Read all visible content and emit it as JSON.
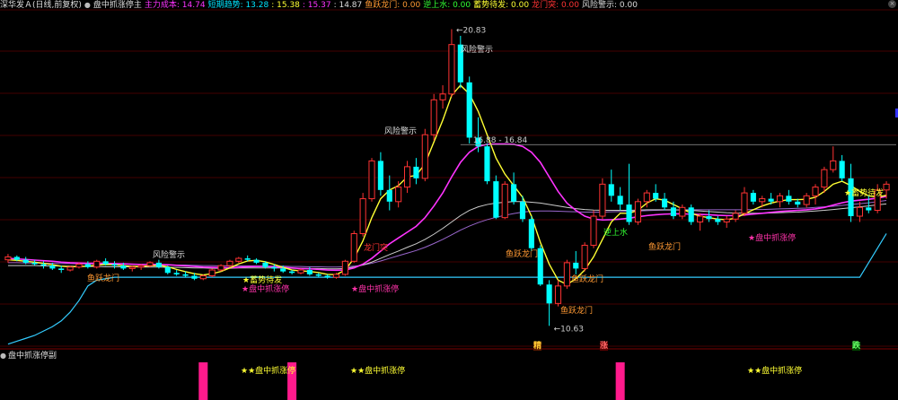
{
  "header": {
    "stock": "深华发Ａ(日线,前复权)",
    "indicator_name": "盘中抓涨停主",
    "items": [
      {
        "label": "主力成本:",
        "value": "14.74",
        "color": "#ff33ff"
      },
      {
        "label": "短期趋势:",
        "value": "13.28",
        "color": "#00e5ff"
      },
      {
        "label": ":",
        "value": "15.38",
        "color": "#ffff33"
      },
      {
        "label": ":",
        "value": "15.37",
        "color": "#ff33ff"
      },
      {
        "label": ":",
        "value": "14.87",
        "color": "#dddddd"
      },
      {
        "label": "鱼跃龙门:",
        "value": "0.00",
        "color": "#ff9933"
      },
      {
        "label": "逆上水:",
        "value": "0.00",
        "color": "#33ff33"
      },
      {
        "label": "蓄势待发:",
        "value": "0.00",
        "color": "#ffff33"
      },
      {
        "label": "龙门突:",
        "value": "0.00",
        "color": "#ff3333"
      },
      {
        "label": "风险警示:",
        "value": "0.00",
        "color": "#dddddd"
      }
    ]
  },
  "sub_panel": {
    "title": "盘中抓涨停副",
    "signal_label": "★★盘中抓涨停"
  },
  "colors": {
    "up": "#ff3333",
    "down": "#00ffff",
    "ma_yellow": "#ffff33",
    "ma_magenta": "#ff33ff",
    "ma_white": "#cccccc",
    "trend_cyan": "#33ccff",
    "signal_pink": "#ff1a8c"
  },
  "price_labels": {
    "high": "20.83",
    "low": "10.63",
    "band": "16.88 - 16.84"
  },
  "labels": {
    "risk": "风险警示",
    "yuyue": "鱼跃龙门",
    "xushi": "蓄势待发",
    "zhangting": "★盘中抓涨停",
    "xushi_star": "★蓄势待发",
    "longmen": "龙门突",
    "nishang": "逆上水"
  },
  "bottom_words": [
    "精",
    "涨",
    "跌"
  ],
  "chart_data": {
    "type": "candlestick",
    "ohlc": [
      [
        12.9,
        13.1,
        12.8,
        13.0
      ],
      [
        13.0,
        13.05,
        12.85,
        12.9
      ],
      [
        12.9,
        13.0,
        12.75,
        12.8
      ],
      [
        12.8,
        12.9,
        12.7,
        12.75
      ],
      [
        12.75,
        12.85,
        12.6,
        12.7
      ],
      [
        12.7,
        12.8,
        12.55,
        12.6
      ],
      [
        12.6,
        12.7,
        12.45,
        12.55
      ],
      [
        12.55,
        12.7,
        12.5,
        12.65
      ],
      [
        12.65,
        12.8,
        12.6,
        12.75
      ],
      [
        12.75,
        12.85,
        12.6,
        12.65
      ],
      [
        12.65,
        12.9,
        12.6,
        12.85
      ],
      [
        12.85,
        12.95,
        12.7,
        12.75
      ],
      [
        12.75,
        12.85,
        12.6,
        12.7
      ],
      [
        12.7,
        12.8,
        12.55,
        12.6
      ],
      [
        12.6,
        12.7,
        12.5,
        12.65
      ],
      [
        12.65,
        12.75,
        12.55,
        12.7
      ],
      [
        12.7,
        12.85,
        12.65,
        12.8
      ],
      [
        12.8,
        12.9,
        12.6,
        12.65
      ],
      [
        12.65,
        12.7,
        12.4,
        12.45
      ],
      [
        12.45,
        12.55,
        12.35,
        12.4
      ],
      [
        12.4,
        12.5,
        12.3,
        12.35
      ],
      [
        12.35,
        12.45,
        12.2,
        12.25
      ],
      [
        12.25,
        12.4,
        12.2,
        12.35
      ],
      [
        12.35,
        12.6,
        12.3,
        12.55
      ],
      [
        12.55,
        12.75,
        12.5,
        12.7
      ],
      [
        12.7,
        12.9,
        12.65,
        12.85
      ],
      [
        12.85,
        13.0,
        12.8,
        12.95
      ],
      [
        12.95,
        13.05,
        12.85,
        12.9
      ],
      [
        12.9,
        12.95,
        12.75,
        12.8
      ],
      [
        12.8,
        12.85,
        12.6,
        12.65
      ],
      [
        12.65,
        12.75,
        12.5,
        12.6
      ],
      [
        12.6,
        12.7,
        12.45,
        12.5
      ],
      [
        12.5,
        12.55,
        12.4,
        12.45
      ],
      [
        12.45,
        12.6,
        12.4,
        12.55
      ],
      [
        12.55,
        12.65,
        12.35,
        12.4
      ],
      [
        12.4,
        12.45,
        12.3,
        12.35
      ],
      [
        12.35,
        12.4,
        12.25,
        12.3
      ],
      [
        12.3,
        12.45,
        12.25,
        12.4
      ],
      [
        12.4,
        12.9,
        12.35,
        12.85
      ],
      [
        12.85,
        13.9,
        12.8,
        13.8
      ],
      [
        13.8,
        15.2,
        13.7,
        15.0
      ],
      [
        15.0,
        16.4,
        14.9,
        16.3
      ],
      [
        16.3,
        16.6,
        15.1,
        15.3
      ],
      [
        15.3,
        15.8,
        14.6,
        14.9
      ],
      [
        14.9,
        15.6,
        14.7,
        15.4
      ],
      [
        15.4,
        16.3,
        15.2,
        16.1
      ],
      [
        16.1,
        16.4,
        15.5,
        15.7
      ],
      [
        15.7,
        17.4,
        15.6,
        17.2
      ],
      [
        17.2,
        18.6,
        17.0,
        18.4
      ],
      [
        18.4,
        18.9,
        18.1,
        18.6
      ],
      [
        18.6,
        20.83,
        18.5,
        20.3
      ],
      [
        20.3,
        20.6,
        18.8,
        19.0
      ],
      [
        19.0,
        19.2,
        16.9,
        17.1
      ],
      [
        17.1,
        17.8,
        16.6,
        16.8
      ],
      [
        16.8,
        16.9,
        15.5,
        15.6
      ],
      [
        15.6,
        15.8,
        14.3,
        14.35
      ],
      [
        14.35,
        15.6,
        14.3,
        15.5
      ],
      [
        15.5,
        15.9,
        14.8,
        14.9
      ],
      [
        14.9,
        15.1,
        14.2,
        14.3
      ],
      [
        14.3,
        14.4,
        13.2,
        13.3
      ],
      [
        13.3,
        13.4,
        12.0,
        12.05
      ],
      [
        12.05,
        12.2,
        10.63,
        11.4
      ],
      [
        11.4,
        12.2,
        11.3,
        12.0
      ],
      [
        12.0,
        12.9,
        11.9,
        12.8
      ],
      [
        12.8,
        13.2,
        12.4,
        12.6
      ],
      [
        12.6,
        13.5,
        12.5,
        13.4
      ],
      [
        13.4,
        14.6,
        13.3,
        14.4
      ],
      [
        14.4,
        15.7,
        14.3,
        15.5
      ],
      [
        15.5,
        16.0,
        14.9,
        15.1
      ],
      [
        15.1,
        15.4,
        14.6,
        14.8
      ],
      [
        14.8,
        16.2,
        14.1,
        14.2
      ],
      [
        14.2,
        15.0,
        14.1,
        14.9
      ],
      [
        14.9,
        15.3,
        14.7,
        15.2
      ],
      [
        15.2,
        15.5,
        14.9,
        15.0
      ],
      [
        15.0,
        15.2,
        14.6,
        14.7
      ],
      [
        14.7,
        14.9,
        14.3,
        14.4
      ],
      [
        14.4,
        14.8,
        14.3,
        14.7
      ],
      [
        14.7,
        14.8,
        14.1,
        14.2
      ],
      [
        14.2,
        14.5,
        13.9,
        14.4
      ],
      [
        14.4,
        14.6,
        14.2,
        14.3
      ],
      [
        14.3,
        14.4,
        14.1,
        14.2
      ],
      [
        14.2,
        14.4,
        14.0,
        14.3
      ],
      [
        14.3,
        14.6,
        14.2,
        14.5
      ],
      [
        14.5,
        15.4,
        14.4,
        15.2
      ],
      [
        15.2,
        15.3,
        14.8,
        14.9
      ],
      [
        14.9,
        15.1,
        14.7,
        15.0
      ],
      [
        15.0,
        15.2,
        14.8,
        14.9
      ],
      [
        14.9,
        15.2,
        14.7,
        15.1
      ],
      [
        15.1,
        15.3,
        14.8,
        14.9
      ],
      [
        14.9,
        15.0,
        14.7,
        14.8
      ],
      [
        14.8,
        15.2,
        14.7,
        15.1
      ],
      [
        15.1,
        15.5,
        14.8,
        15.4
      ],
      [
        15.4,
        16.1,
        15.2,
        16.0
      ],
      [
        16.0,
        16.8,
        15.9,
        16.3
      ],
      [
        16.3,
        16.5,
        15.6,
        15.7
      ],
      [
        15.7,
        16.2,
        14.2,
        14.4
      ],
      [
        14.4,
        14.9,
        14.2,
        14.7
      ],
      [
        14.7,
        15.1,
        14.5,
        14.6
      ],
      [
        14.6,
        15.5,
        14.5,
        15.3
      ],
      [
        15.3,
        15.6,
        15.0,
        15.5
      ]
    ],
    "yellow_ma": [
      12.9,
      12.88,
      12.85,
      12.82,
      12.78,
      12.73,
      12.68,
      12.66,
      12.67,
      12.68,
      12.72,
      12.74,
      12.73,
      12.7,
      12.67,
      12.67,
      12.69,
      12.71,
      12.66,
      12.57,
      12.49,
      12.42,
      12.38,
      12.42,
      12.5,
      12.62,
      12.76,
      12.86,
      12.88,
      12.83,
      12.74,
      12.64,
      12.55,
      12.52,
      12.5,
      12.46,
      12.4,
      12.39,
      12.55,
      12.95,
      13.55,
      14.35,
      15.0,
      15.3,
      15.45,
      15.75,
      15.8,
      16.2,
      16.95,
      17.7,
      18.55,
      18.9,
      18.6,
      18.0,
      17.2,
      16.4,
      15.85,
      15.45,
      15.05,
      14.4,
      13.5,
      12.75,
      12.2,
      12.05,
      12.25,
      12.55,
      13.0,
      13.6,
      14.2,
      14.5,
      14.5,
      14.6,
      14.85,
      15.0,
      14.95,
      14.8,
      14.65,
      14.5,
      14.4,
      14.35,
      14.3,
      14.28,
      14.33,
      14.48,
      14.62,
      14.75,
      14.85,
      14.92,
      14.97,
      14.97,
      14.98,
      15.05,
      15.25,
      15.5,
      15.6,
      15.45,
      15.25,
      15.1,
      15.05,
      15.12
    ],
    "magenta_ma": [
      12.95,
      12.93,
      12.91,
      12.89,
      12.87,
      12.85,
      12.82,
      12.8,
      12.79,
      12.78,
      12.78,
      12.78,
      12.77,
      12.76,
      12.75,
      12.74,
      12.74,
      12.74,
      12.73,
      12.71,
      12.69,
      12.67,
      12.65,
      12.64,
      12.63,
      12.63,
      12.64,
      12.66,
      12.67,
      12.67,
      12.66,
      12.64,
      12.62,
      12.6,
      12.59,
      12.57,
      12.55,
      12.54,
      12.55,
      12.62,
      12.75,
      12.95,
      13.2,
      13.45,
      13.65,
      13.85,
      14.05,
      14.35,
      14.75,
      15.2,
      15.75,
      16.25,
      16.6,
      16.8,
      16.87,
      16.88,
      16.88,
      16.87,
      16.8,
      16.6,
      16.25,
      15.75,
      15.25,
      14.85,
      14.6,
      14.4,
      14.3,
      14.27,
      14.28,
      14.3,
      14.33,
      14.38,
      14.42,
      14.45,
      14.47,
      14.48,
      14.48,
      14.47,
      14.46,
      14.45,
      14.43,
      14.42,
      14.42,
      14.44,
      14.47,
      14.5,
      14.53,
      14.56,
      14.58,
      14.6,
      14.62,
      14.65,
      14.7,
      14.78,
      14.86,
      14.92,
      14.95,
      14.98,
      15.02,
      15.08
    ],
    "white_ma": [
      12.7,
      12.7,
      12.7,
      12.7,
      12.69,
      12.69,
      12.68,
      12.68,
      12.67,
      12.67,
      12.67,
      12.66,
      12.66,
      12.66,
      12.66,
      12.65,
      12.65,
      12.65,
      12.64,
      12.64,
      12.63,
      12.62,
      12.62,
      12.61,
      12.61,
      12.61,
      12.62,
      12.62,
      12.62,
      12.62,
      12.62,
      12.62,
      12.61,
      12.61,
      12.6,
      12.6,
      12.59,
      12.59,
      12.6,
      12.65,
      12.72,
      12.82,
      12.95,
      13.08,
      13.2,
      13.33,
      13.45,
      13.6,
      13.78,
      13.98,
      14.2,
      14.42,
      14.6,
      14.72,
      14.8,
      14.85,
      14.88,
      14.9,
      14.9,
      14.88,
      14.85,
      14.8,
      14.75,
      14.7,
      14.66,
      14.63,
      14.61,
      14.6,
      14.6,
      14.6,
      14.6,
      14.61,
      14.62,
      14.62,
      14.62,
      14.62,
      14.61,
      14.6,
      14.58,
      14.56,
      14.54,
      14.52,
      14.51,
      14.5,
      14.5,
      14.5,
      14.51,
      14.52,
      14.53,
      14.54,
      14.56,
      14.58,
      14.6,
      14.63,
      14.66,
      14.69,
      14.72,
      14.75,
      14.79,
      14.82
    ],
    "purple_ma": [
      12.8,
      12.8,
      12.79,
      12.79,
      12.78,
      12.78,
      12.77,
      12.77,
      12.76,
      12.76,
      12.76,
      12.75,
      12.75,
      12.75,
      12.74,
      12.74,
      12.74,
      12.73,
      12.73,
      12.72,
      12.72,
      12.71,
      12.7,
      12.7,
      12.69,
      12.69,
      12.69,
      12.69,
      12.69,
      12.68,
      12.68,
      12.68,
      12.67,
      12.67,
      12.66,
      12.66,
      12.65,
      12.65,
      12.66,
      12.68,
      12.72,
      12.78,
      12.86,
      12.95,
      13.04,
      13.13,
      13.22,
      13.33,
      13.46,
      13.6,
      13.76,
      13.92,
      14.06,
      14.18,
      14.28,
      14.36,
      14.43,
      14.49,
      14.54,
      14.57,
      14.58,
      14.58,
      14.57,
      14.56,
      14.55,
      14.54,
      14.54,
      14.54,
      14.55,
      14.56,
      14.57,
      14.58,
      14.59,
      14.6,
      14.61,
      14.61,
      14.62,
      14.62,
      14.62,
      14.62,
      14.62,
      14.62,
      14.62,
      14.62,
      14.63,
      14.63,
      14.64,
      14.65,
      14.66,
      14.67,
      14.68,
      14.7,
      14.72,
      14.74,
      14.77,
      14.8,
      14.83,
      14.86,
      14.9,
      14.94
    ],
    "cyan_trend": [
      10.0,
      10.1,
      10.2,
      10.3,
      10.45,
      10.6,
      10.8,
      11.1,
      11.5,
      12.0,
      12.2,
      12.25,
      12.3,
      12.3,
      12.3,
      12.3,
      12.3,
      12.3,
      12.3,
      12.3,
      12.3,
      12.3,
      12.3,
      12.3,
      12.3,
      12.3,
      12.3,
      12.3,
      12.3,
      12.3,
      12.3,
      12.3,
      12.3,
      12.3,
      12.3,
      12.3,
      12.3,
      12.3,
      12.3,
      12.3,
      12.3,
      12.3,
      12.3,
      12.3,
      12.3,
      12.3,
      12.3,
      12.3,
      12.3,
      12.3,
      12.3,
      12.3,
      12.3,
      12.3,
      12.3,
      12.3,
      12.3,
      12.3,
      12.3,
      12.3,
      12.3,
      12.3,
      12.3,
      12.3,
      12.3,
      12.3,
      12.3,
      12.3,
      12.3,
      12.3,
      12.3,
      12.3,
      12.3,
      12.3,
      12.3,
      12.3,
      12.3,
      12.3,
      12.3,
      12.3,
      12.3,
      12.3,
      12.3,
      12.3,
      12.3,
      12.3,
      12.3,
      12.3,
      12.3,
      12.3,
      12.3,
      12.3,
      12.3,
      12.3,
      12.3,
      12.3,
      12.3,
      12.8,
      13.3,
      13.8
    ],
    "ylim": [
      10.3,
      21.4
    ],
    "sub_signals": [
      22,
      32,
      69
    ]
  }
}
